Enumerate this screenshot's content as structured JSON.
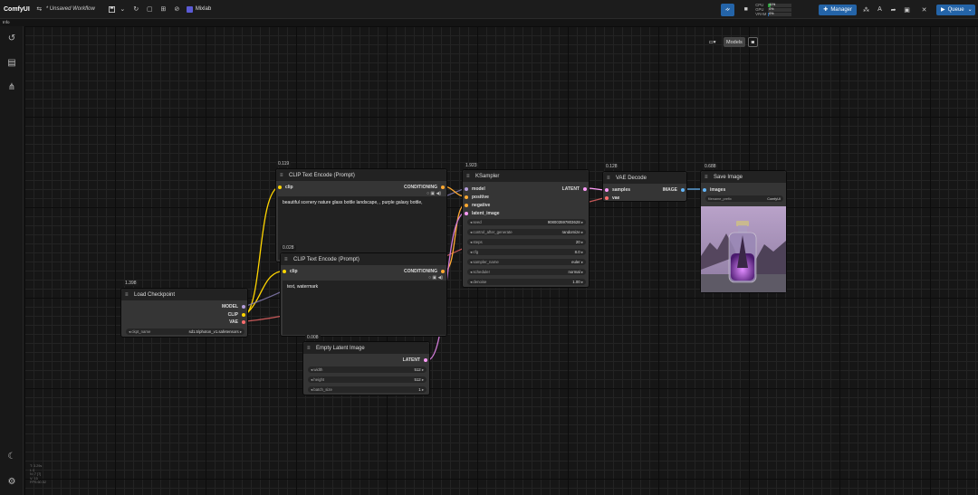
{
  "app": {
    "title": "ComfyUI",
    "workflow_title": "* Unsaved Workflow",
    "info": "Info",
    "mixlab": "Mixlab"
  },
  "hardware": {
    "cpu": {
      "label": "CPU",
      "value": "11%",
      "fraction": 0.11,
      "color": "#2c9a3a"
    },
    "gpu": {
      "label": "GPU",
      "value": "0%",
      "fraction": 0.0,
      "color": "#2c9a3a"
    },
    "vram": {
      "label": "VRAM",
      "value": "0%",
      "fraction": 0.03,
      "color": "#2464a8"
    }
  },
  "toolbar": {
    "manager_label": "Manager",
    "queue_label": "Queue"
  },
  "canvas_tools": {
    "models_label": "Models"
  },
  "nodes": {
    "clip1": {
      "badge": "0.119",
      "title": "CLIP Text Encode (Prompt)",
      "in": "clip",
      "out": "CONDITIONING",
      "text": "beautiful scenery nature glass bottle landscape, , purple galaxy bottle,"
    },
    "clip2": {
      "badge": "0.028",
      "title": "CLIP Text Encode (Prompt)",
      "in": "clip",
      "out": "CONDITIONING",
      "text": "text, watermark"
    },
    "ckpt": {
      "badge": "1.398",
      "title": "Load Checkpoint",
      "out_model": "MODEL",
      "out_clip": "CLIP",
      "out_vae": "VAE",
      "w_name": "ckpt_name",
      "w_val": "sd1.5\\photon_v1.safetensors"
    },
    "latent": {
      "badge": "0.008",
      "title": "Empty Latent Image",
      "out": "LATENT",
      "widgets": [
        {
          "name": "width",
          "value": "512"
        },
        {
          "name": "height",
          "value": "512"
        },
        {
          "name": "batch_size",
          "value": "1"
        }
      ]
    },
    "ksampler": {
      "badge": "1.923",
      "title": "KSampler",
      "in_model": "model",
      "in_pos": "positive",
      "in_neg": "negative",
      "in_latent": "latent_image",
      "out": "LATENT",
      "widgets": [
        {
          "name": "seed",
          "value": "908003597803628"
        },
        {
          "name": "control_after_generate",
          "value": "randomize"
        },
        {
          "name": "steps",
          "value": "20"
        },
        {
          "name": "cfg",
          "value": "8.0"
        },
        {
          "name": "sampler_name",
          "value": "euler"
        },
        {
          "name": "scheduler",
          "value": "normal"
        },
        {
          "name": "denoise",
          "value": "1.00"
        }
      ]
    },
    "vae": {
      "badge": "0.128",
      "title": "VAE Decode",
      "in_samples": "samples",
      "in_vae": "vae",
      "out": "IMAGE"
    },
    "save": {
      "badge": "0.688",
      "title": "Save Image",
      "in": "images",
      "w_name": "filename_prefix",
      "w_val": "ComfyUI"
    }
  },
  "colors": {
    "model": "#b39ddb",
    "clip": "#ffd500",
    "vae": "#ff6e6e",
    "conditioning": "#ffa931",
    "latent": "#ff9cf9",
    "image": "#64b5f6"
  },
  "stats": [
    "T: 3.29s",
    "I: 0",
    "N: 7 [7]",
    "V: 15",
    "FPS:60.52"
  ]
}
